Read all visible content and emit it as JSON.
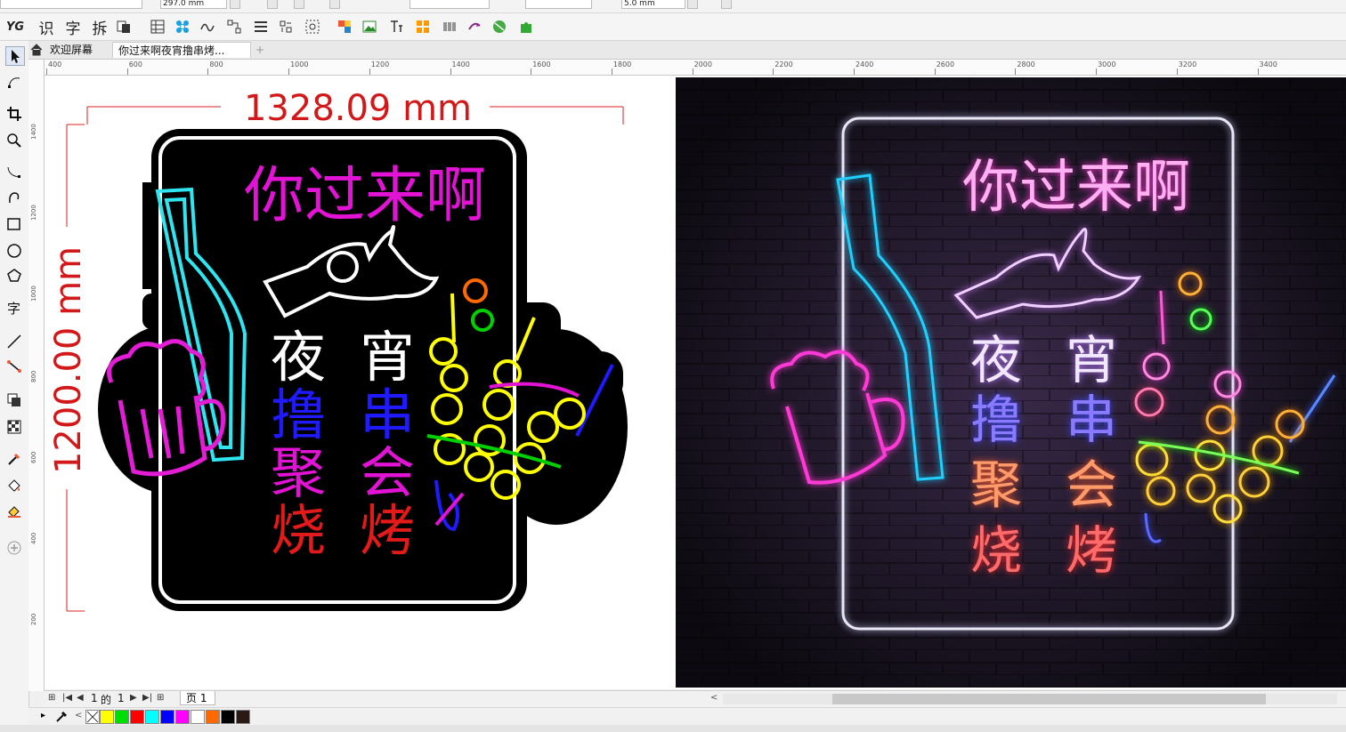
{
  "propbar": {
    "width_field": "297.0 mm",
    "nudge_field": "5.0 mm"
  },
  "toolbar": {
    "logo": "YG",
    "btn_recognize": "识",
    "btn_char": "字",
    "btn_split": "拆"
  },
  "tabs": [
    {
      "label": "欢迎屏幕"
    },
    {
      "label": "你过来啊夜宵撸串烤..."
    },
    {
      "label": "+"
    }
  ],
  "hruler": {
    "labels": [
      "400",
      "600",
      "800",
      "1000",
      "1200",
      "1400",
      "1600",
      "1800",
      "2000",
      "2200",
      "2400",
      "2600",
      "2800",
      "3000",
      "3200",
      "3400"
    ]
  },
  "vruler": {
    "labels": [
      "1400",
      "1200",
      "1000",
      "800",
      "600",
      "400",
      "200"
    ]
  },
  "design": {
    "width_label": "1328.09 mm",
    "height_label": "1200.00 mm",
    "headline": "你过来啊",
    "col1": [
      "夜",
      "撸",
      "聚",
      "烧"
    ],
    "col2": [
      "宵",
      "串",
      "会",
      "烤"
    ]
  },
  "photo": {
    "headline": "你过来啊",
    "col1": [
      "夜",
      "撸",
      "聚",
      "烧"
    ],
    "col2": [
      "宵",
      "串",
      "会",
      "烤"
    ]
  },
  "pagenav": {
    "counter_current": "1",
    "counter_sep": "的",
    "counter_total": "1",
    "page_tab": "页 1"
  },
  "palette": {
    "colors": [
      "#ffff00",
      "#00e000",
      "#ff0000",
      "#00ffff",
      "#0000ff",
      "#ff00ff",
      "#ffffff",
      "#ff6a00",
      "#000000",
      "#2a1a14"
    ]
  }
}
